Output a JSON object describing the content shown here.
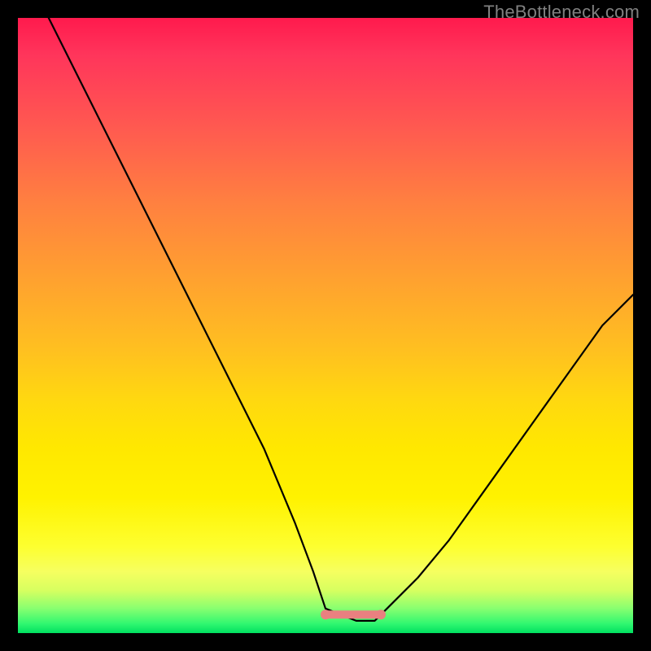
{
  "watermark": {
    "text": "TheBottleneck.com"
  },
  "chart_data": {
    "type": "line",
    "title": "",
    "xlabel": "",
    "ylabel": "",
    "xlim": [
      0,
      100
    ],
    "ylim": [
      0,
      100
    ],
    "grid": false,
    "legend": false,
    "background_gradient": {
      "direction": "top-to-bottom",
      "stops": [
        {
          "pos": 0.0,
          "color": "#ff1a4d"
        },
        {
          "pos": 0.5,
          "color": "#ffd000"
        },
        {
          "pos": 0.92,
          "color": "#f6ff60"
        },
        {
          "pos": 1.0,
          "color": "#00e060"
        }
      ],
      "meaning": "red = high bottleneck, green = no bottleneck"
    },
    "series": [
      {
        "name": "bottleneck-curve",
        "color": "#000000",
        "x": [
          5,
          10,
          15,
          20,
          25,
          30,
          35,
          40,
          45,
          48,
          50,
          55,
          58,
          60,
          65,
          70,
          75,
          80,
          85,
          90,
          95,
          100
        ],
        "y": [
          100,
          90,
          80,
          70,
          60,
          50,
          40,
          30,
          18,
          10,
          4,
          2,
          2,
          4,
          9,
          15,
          22,
          29,
          36,
          43,
          50,
          55
        ]
      },
      {
        "name": "optimal-zone-marker",
        "color": "#e98080",
        "type": "area",
        "x": [
          50,
          59
        ],
        "y": [
          3,
          3
        ],
        "note": "flat pink band at curve minimum"
      }
    ],
    "optimal_point": {
      "x_range": [
        50,
        59
      ],
      "y": 2
    }
  }
}
